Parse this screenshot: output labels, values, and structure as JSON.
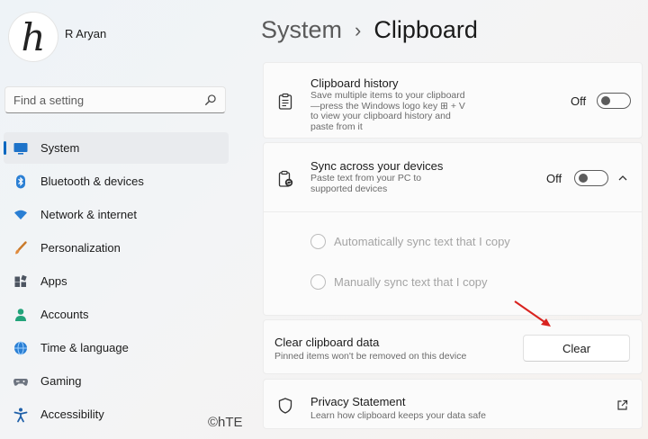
{
  "user": {
    "avatar_glyph": "h",
    "name": "R Aryan"
  },
  "search": {
    "placeholder": "Find a setting",
    "icon": "search-icon"
  },
  "sidebar": {
    "items": [
      {
        "label": "System",
        "icon": "monitor-icon",
        "active": true
      },
      {
        "label": "Bluetooth & devices",
        "icon": "bluetooth-icon"
      },
      {
        "label": "Network & internet",
        "icon": "wifi-icon"
      },
      {
        "label": "Personalization",
        "icon": "brush-icon"
      },
      {
        "label": "Apps",
        "icon": "apps-icon"
      },
      {
        "label": "Accounts",
        "icon": "person-icon"
      },
      {
        "label": "Time & language",
        "icon": "globe-icon"
      },
      {
        "label": "Gaming",
        "icon": "gamepad-icon"
      },
      {
        "label": "Accessibility",
        "icon": "accessibility-icon"
      }
    ]
  },
  "header": {
    "crumb": "System",
    "separator": "›",
    "title": "Clipboard"
  },
  "clipboard_history": {
    "title": "Clipboard history",
    "desc_lines": [
      "Save multiple items to your clipboard",
      "—press the Windows logo key ⊞ + V",
      "to view your clipboard history and",
      "paste from it"
    ],
    "state": "Off"
  },
  "sync": {
    "title": "Sync across your devices",
    "desc_lines": [
      "Paste text from your PC to",
      "supported devices"
    ],
    "state": "Off",
    "options": [
      "Automatically sync text that I copy",
      "Manually sync text that I copy"
    ]
  },
  "clear": {
    "title": "Clear clipboard data",
    "desc": "Pinned items won't be removed on this device",
    "button": "Clear"
  },
  "privacy": {
    "title": "Privacy Statement",
    "desc": "Learn how clipboard keeps your data safe"
  },
  "watermark": "©hTE",
  "colors": {
    "accent": "#0067c0",
    "annotation_arrow": "#d9231f"
  }
}
